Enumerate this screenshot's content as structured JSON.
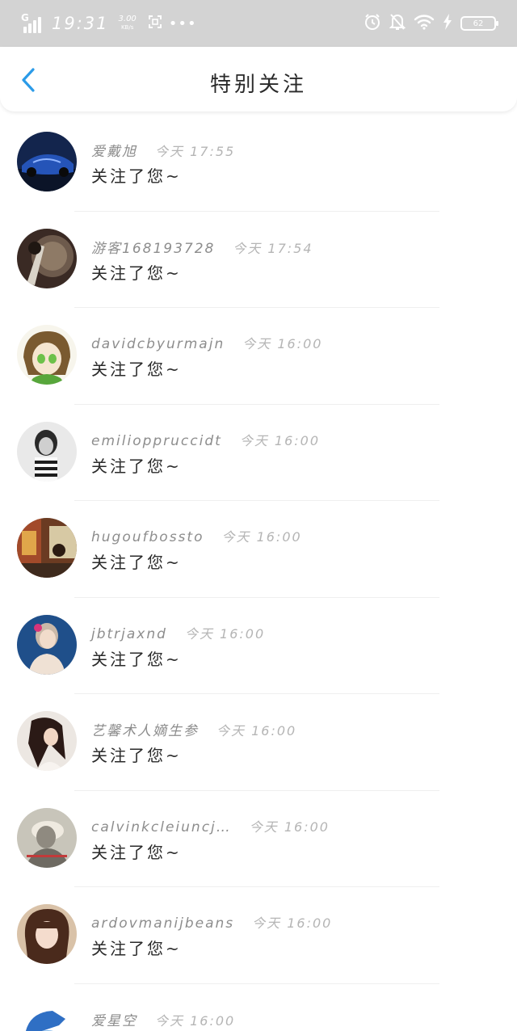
{
  "status_bar": {
    "network": "G",
    "time": "19:31",
    "speed_value": "3.00",
    "speed_unit": "KB/s",
    "battery": "62",
    "icons": [
      "signal-icon",
      "screenshot-icon",
      "more-dots-icon",
      "alarm-icon",
      "mute-bell-icon",
      "wifi-icon",
      "charging-icon",
      "battery-icon"
    ]
  },
  "header": {
    "title": "特别关注",
    "back_icon": "chevron-left-icon"
  },
  "colors": {
    "accent": "#2b9be8",
    "status_bar_bg": "#d3d3d3",
    "name_text": "#8d8d8d",
    "time_text": "#b5b5b5"
  },
  "items": [
    {
      "name": "爱戴旭",
      "time": "今天 17:55",
      "message": "关注了您~"
    },
    {
      "name": "游客168193728",
      "time": "今天 17:54",
      "message": "关注了您~"
    },
    {
      "name": "davidcbyurmajn",
      "time": "今天 16:00",
      "message": "关注了您~"
    },
    {
      "name": "emilioppruccidt",
      "time": "今天 16:00",
      "message": "关注了您~"
    },
    {
      "name": "hugoufbossto",
      "time": "今天 16:00",
      "message": "关注了您~"
    },
    {
      "name": "jbtrjaxnd",
      "time": "今天 16:00",
      "message": "关注了您~"
    },
    {
      "name": "艺馨术人嫡生参",
      "time": "今天 16:00",
      "message": "关注了您~"
    },
    {
      "name": "calvinkcleiuncj…",
      "time": "今天 16:00",
      "message": "关注了您~"
    },
    {
      "name": "ardovmanijbeans",
      "time": "今天 16:00",
      "message": "关注了您~"
    },
    {
      "name": "爱星空",
      "time": "今天 16:00",
      "message": ""
    }
  ]
}
